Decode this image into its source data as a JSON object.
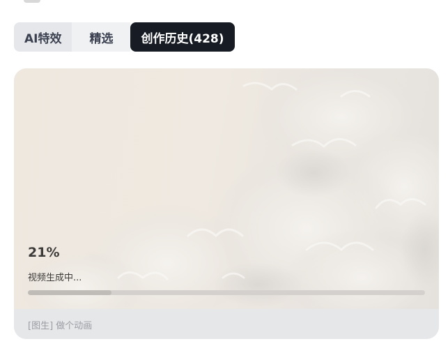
{
  "tabs": [
    {
      "label": "AI特效"
    },
    {
      "label": "精选"
    },
    {
      "label": "创作历史(428)"
    }
  ],
  "card": {
    "progress_percent_text": "21%",
    "progress_fraction": 0.21,
    "status_text": "视频生成中...",
    "prompt_text": "[图生] 做个动画",
    "image_description_icon": "flowers-thumbnail"
  },
  "colors": {
    "active_tab_bg": "#171b24",
    "active_tab_text": "#ffffff",
    "inactive_tab_text": "#3b4150",
    "footer_text": "#9a9ca3"
  }
}
